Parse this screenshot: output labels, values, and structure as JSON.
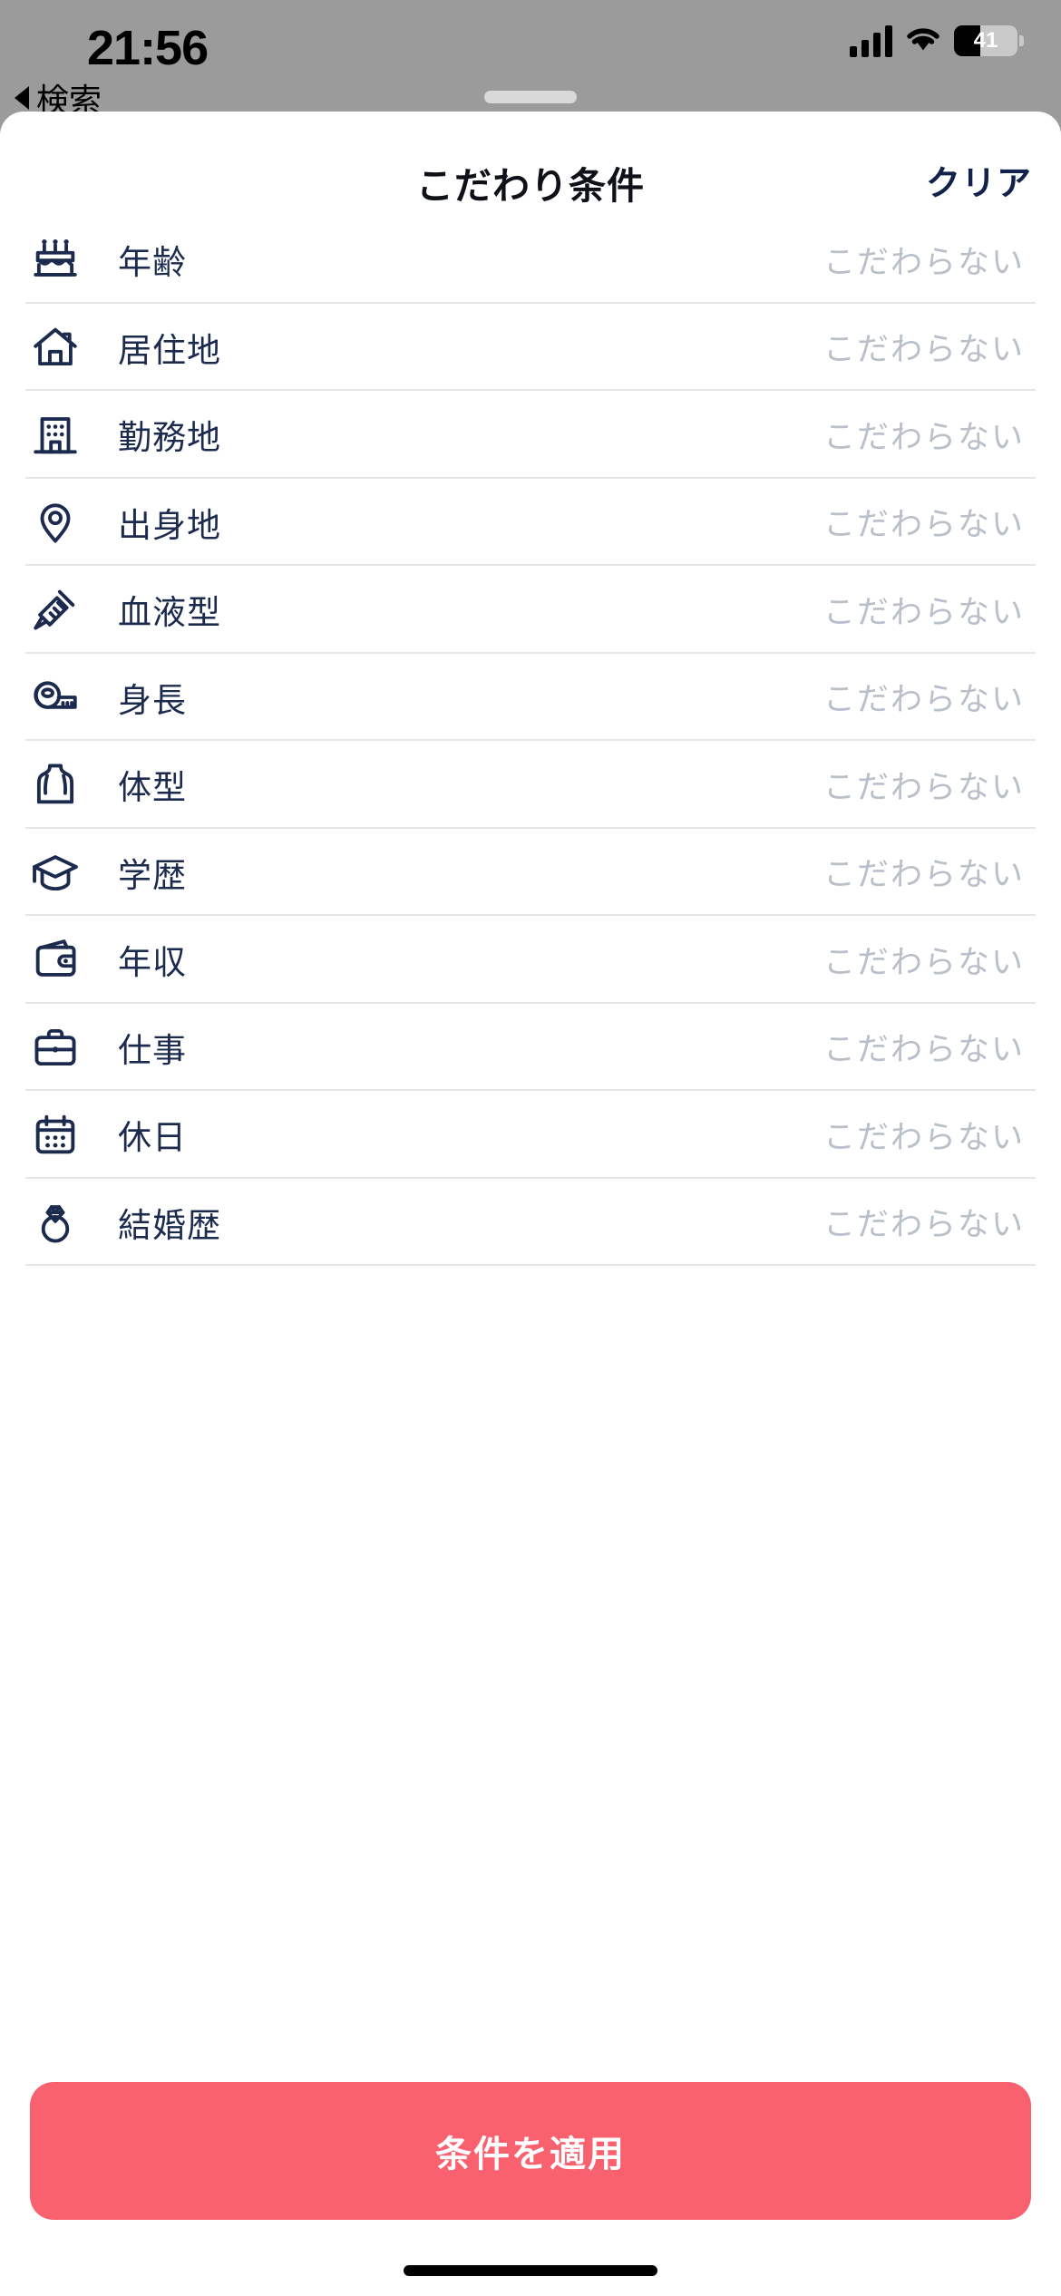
{
  "status_bar": {
    "time": "21:56",
    "back_label": "検索",
    "battery_percent": "41",
    "icons": [
      "signal-bars-icon",
      "wifi-icon",
      "battery-icon"
    ]
  },
  "header": {
    "title": "こだわり条件",
    "clear_label": "クリア"
  },
  "colors": {
    "accent": "#f9616f",
    "navy": "#1b2a4d",
    "muted": "#b9c0ca",
    "backdrop": "#9b9b9b"
  },
  "list": {
    "items": [
      {
        "icon": "birthday-cake-icon",
        "label": "年齢",
        "value": "こだわらない"
      },
      {
        "icon": "house-icon",
        "label": "居住地",
        "value": "こだわらない"
      },
      {
        "icon": "office-building-icon",
        "label": "勤務地",
        "value": "こだわらない"
      },
      {
        "icon": "map-pin-icon",
        "label": "出身地",
        "value": "こだわらない"
      },
      {
        "icon": "syringe-icon",
        "label": "血液型",
        "value": "こだわらない"
      },
      {
        "icon": "tape-measure-icon",
        "label": "身長",
        "value": "こだわらない"
      },
      {
        "icon": "body-torso-icon",
        "label": "体型",
        "value": "こだわらない"
      },
      {
        "icon": "graduation-cap-icon",
        "label": "学歴",
        "value": "こだわらない"
      },
      {
        "icon": "wallet-icon",
        "label": "年収",
        "value": "こだわらない"
      },
      {
        "icon": "briefcase-icon",
        "label": "仕事",
        "value": "こだわらない"
      },
      {
        "icon": "calendar-icon",
        "label": "休日",
        "value": "こだわらない"
      },
      {
        "icon": "ring-icon",
        "label": "結婚歴",
        "value": "こだわらない"
      }
    ]
  },
  "footer": {
    "apply_label": "条件を適用"
  }
}
